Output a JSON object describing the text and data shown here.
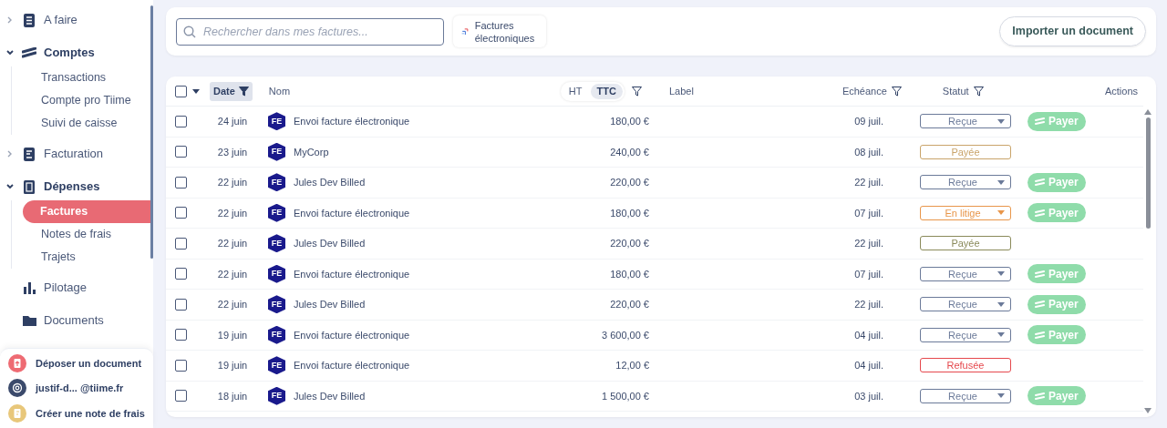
{
  "sidebar": {
    "items": [
      {
        "label": "A faire",
        "expanded": false
      },
      {
        "label": "Comptes",
        "expanded": true,
        "children": [
          {
            "label": "Transactions",
            "selected": false
          },
          {
            "label": "Compte pro Tiime",
            "selected": false
          },
          {
            "label": "Suivi de caisse",
            "selected": false
          }
        ]
      },
      {
        "label": "Facturation",
        "expanded": false
      },
      {
        "label": "Dépenses",
        "expanded": true,
        "children": [
          {
            "label": "Factures",
            "selected": true
          },
          {
            "label": "Notes de frais",
            "selected": false
          },
          {
            "label": "Trajets",
            "selected": false
          }
        ]
      },
      {
        "label": "Pilotage"
      },
      {
        "label": "Documents"
      }
    ],
    "footer": [
      {
        "label": "Déposer un document",
        "color": "#ee6b73"
      },
      {
        "label": "justif-d... @tiime.fr",
        "color": "#3b4a6b"
      },
      {
        "label": "Créer une note de frais",
        "color": "#e8c77a"
      }
    ]
  },
  "toolbar": {
    "search": {
      "placeholder": "Rechercher dans mes factures..."
    },
    "e_invoice_button": "Factures électroniques",
    "import_button": "Importer un document"
  },
  "table": {
    "select_all": {
      "checked": false
    },
    "header": {
      "date": "Date",
      "name": "Nom",
      "toggle": [
        {
          "label": "HT",
          "selected": false
        },
        {
          "label": "TTC",
          "selected": true
        }
      ],
      "label": "Label",
      "due": "Echéance",
      "status": "Statut",
      "actions": "Actions"
    },
    "rows": [
      {
        "date": "24 juin",
        "badge": "FE",
        "name": "Envoi facture électronique",
        "amount": "180,00 €",
        "due": "09 juil.",
        "status": "Reçue",
        "kind": "dropdown",
        "color": "#6b7a99",
        "action": "Payer",
        "checked": false
      },
      {
        "date": "23 juin",
        "badge": "FE",
        "name": "MyCorp",
        "amount": "240,00 €",
        "due": "08 juil.",
        "status": "Payée",
        "kind": "badge",
        "color": "#c9a46a",
        "checked": false
      },
      {
        "date": "22 juin",
        "badge": "FE",
        "name": "Jules Dev Billed",
        "amount": "220,00 €",
        "due": "22 juil.",
        "status": "Reçue",
        "kind": "dropdown",
        "color": "#6b7a99",
        "action": "Payer",
        "checked": false
      },
      {
        "date": "22 juin",
        "badge": "FE",
        "name": "Envoi facture électronique",
        "amount": "180,00 €",
        "due": "07 juil.",
        "status": "En litige",
        "kind": "dropdown",
        "color": "#e8964a",
        "action": "Payer",
        "checked": false
      },
      {
        "date": "22 juin",
        "badge": "FE",
        "name": "Jules Dev Billed",
        "amount": "220,00 €",
        "due": "22 juil.",
        "status": "Payée",
        "kind": "badge",
        "color": "#8a8a5a",
        "checked": false
      },
      {
        "date": "22 juin",
        "badge": "FE",
        "name": "Envoi facture électronique",
        "amount": "180,00 €",
        "due": "07 juil.",
        "status": "Reçue",
        "kind": "dropdown",
        "color": "#6b7a99",
        "action": "Payer",
        "checked": false
      },
      {
        "date": "22 juin",
        "badge": "FE",
        "name": "Jules Dev Billed",
        "amount": "220,00 €",
        "due": "22 juil.",
        "status": "Reçue",
        "kind": "dropdown",
        "color": "#6b7a99",
        "action": "Payer",
        "checked": false
      },
      {
        "date": "19 juin",
        "badge": "FE",
        "name": "Envoi facture électronique",
        "amount": "3 600,00 €",
        "due": "04 juil.",
        "status": "Reçue",
        "kind": "dropdown",
        "color": "#6b7a99",
        "action": "Payer",
        "checked": false
      },
      {
        "date": "19 juin",
        "badge": "FE",
        "name": "Envoi facture électronique",
        "amount": "12,00 €",
        "due": "04 juil.",
        "status": "Refusée",
        "kind": "badge",
        "color": "#e5484d",
        "checked": false
      },
      {
        "date": "18 juin",
        "badge": "FE",
        "name": "Jules Dev Billed",
        "amount": "1 500,00 €",
        "due": "03 juil.",
        "status": "Reçue",
        "kind": "dropdown",
        "color": "#6b7a99",
        "action": "Payer",
        "checked": false
      }
    ]
  }
}
